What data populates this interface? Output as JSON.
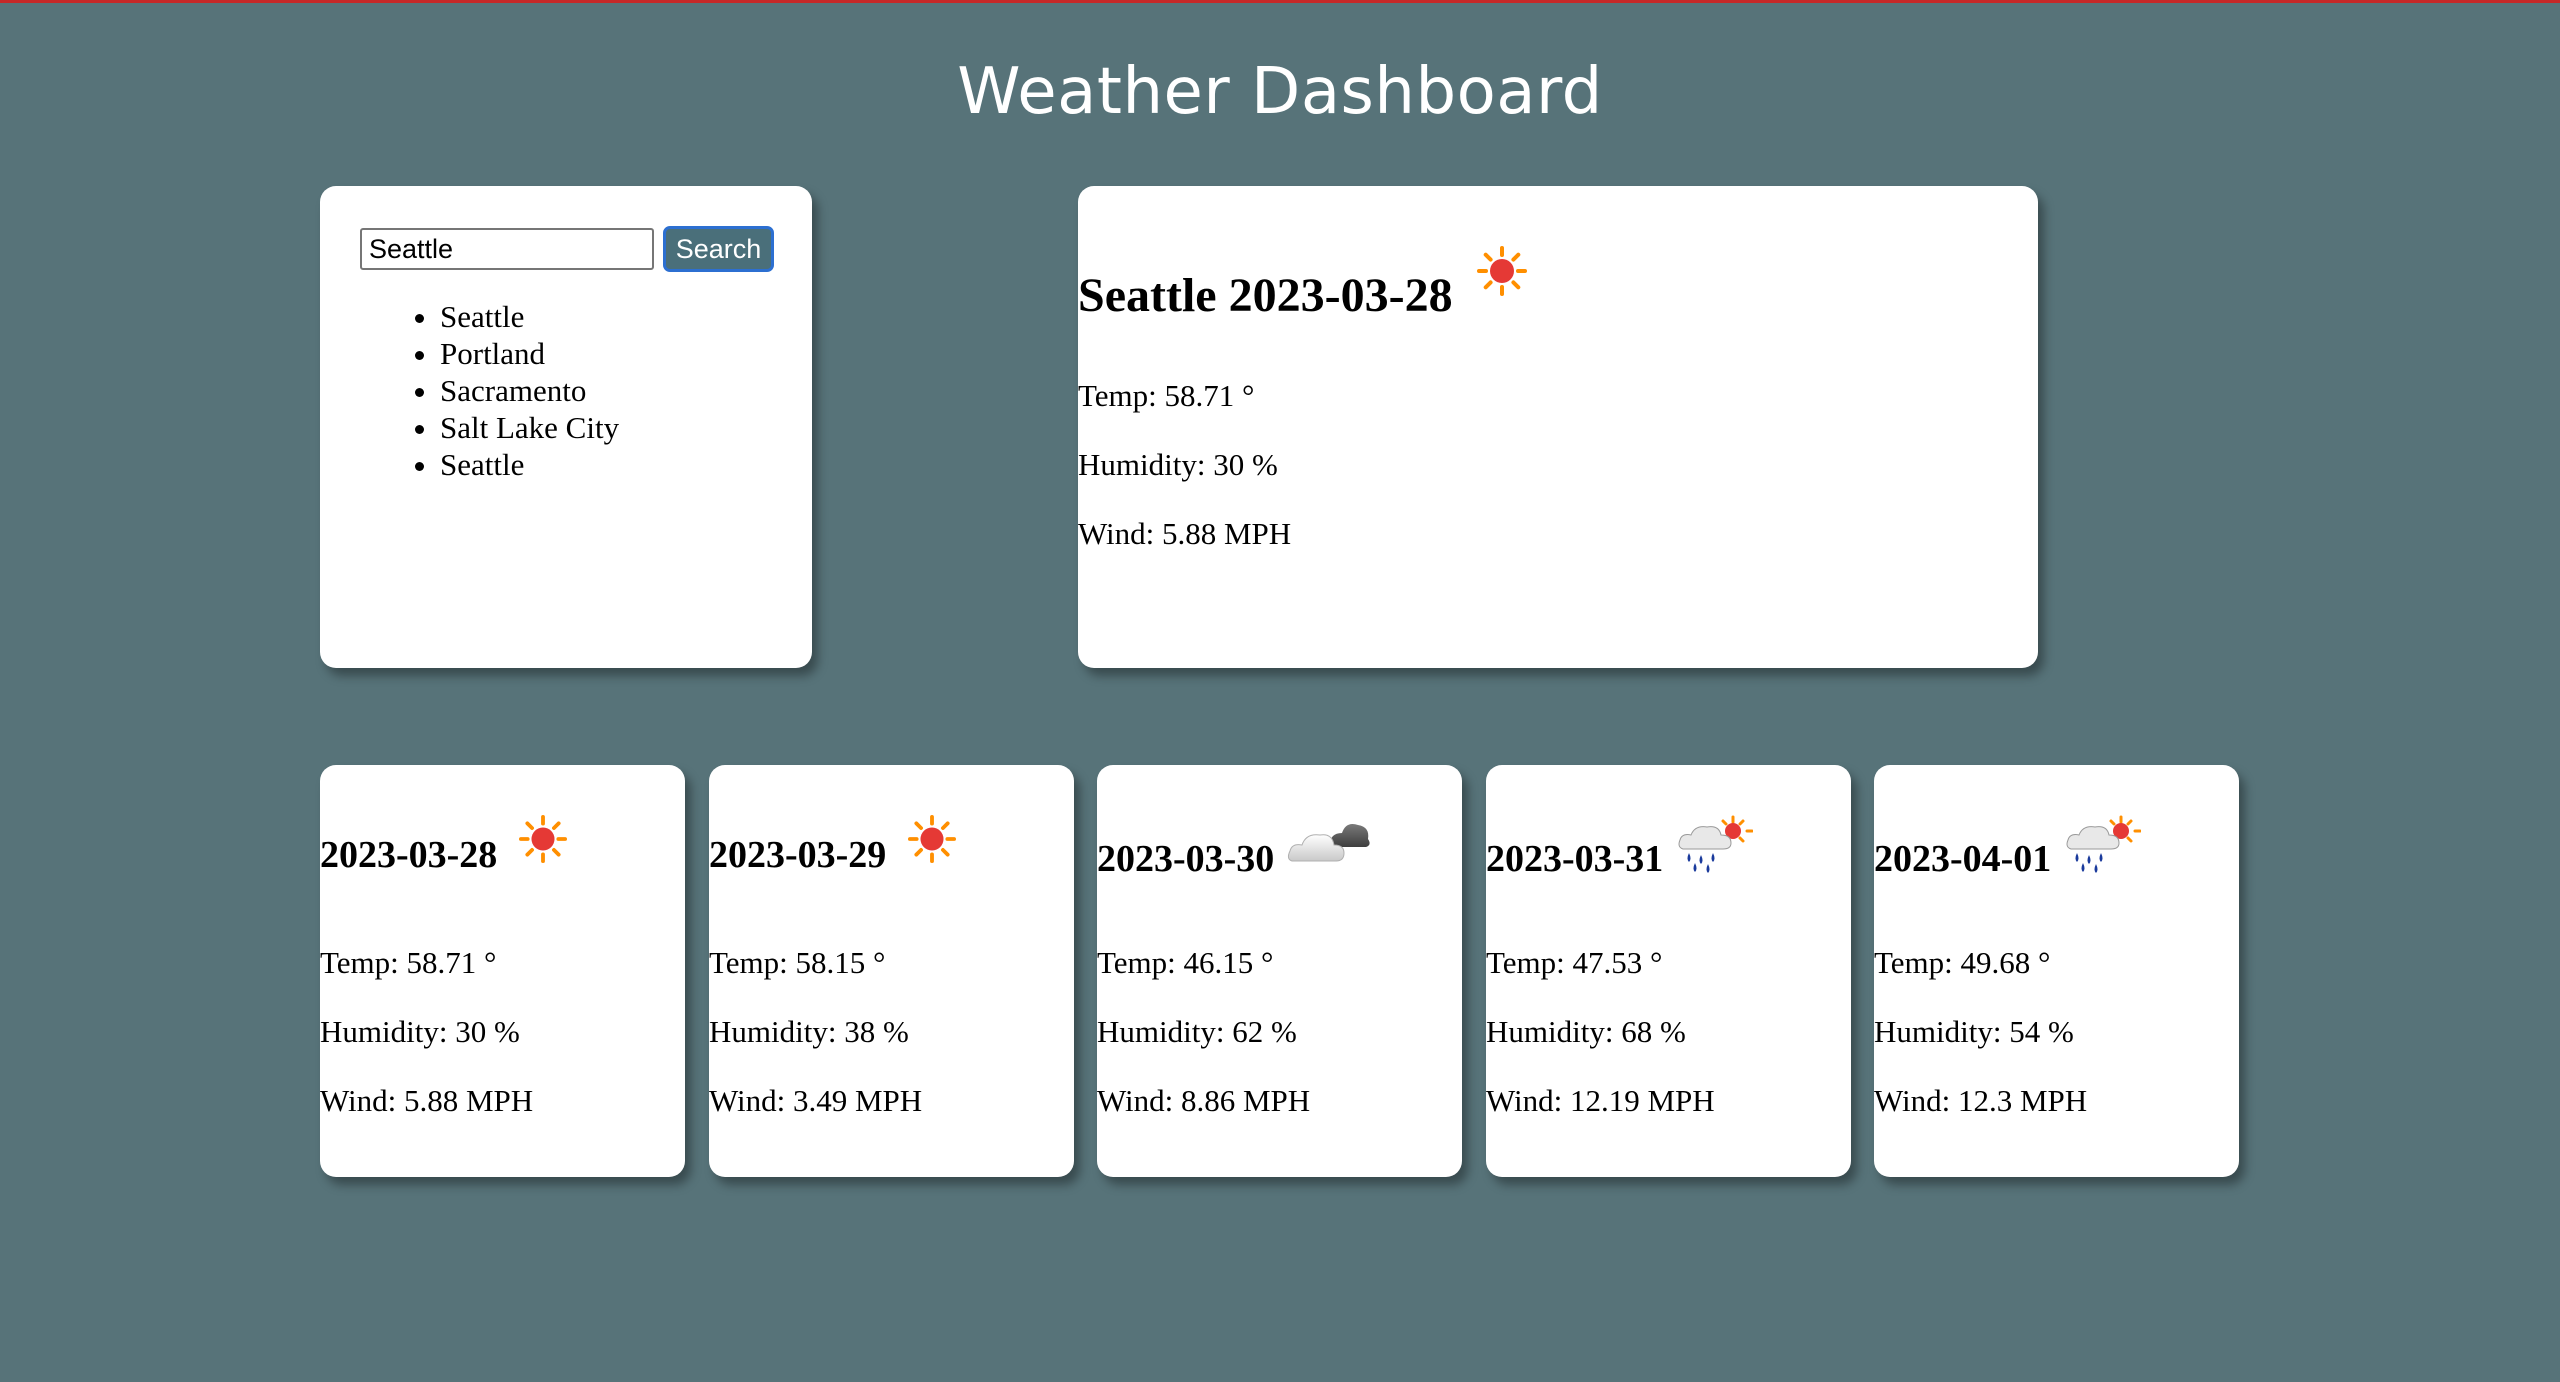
{
  "header": {
    "title": "Weather Dashboard"
  },
  "search": {
    "value": "Seattle",
    "button_label": "Search"
  },
  "history": [
    "Seattle",
    "Portland",
    "Sacramento",
    "Salt Lake City",
    "Seattle"
  ],
  "current": {
    "heading": "Seattle 2023-03-28",
    "icon": "sun-icon",
    "temp": "Temp: 58.71 °",
    "humidity": "Humidity: 30 %",
    "wind": "Wind: 5.88 MPH"
  },
  "forecast": [
    {
      "date": "2023-03-28",
      "icon": "sun-icon",
      "temp": "Temp: 58.71 °",
      "humidity": "Humidity: 30 %",
      "wind": "Wind: 5.88 MPH"
    },
    {
      "date": "2023-03-29",
      "icon": "sun-icon",
      "temp": "Temp: 58.15 °",
      "humidity": "Humidity: 38 %",
      "wind": "Wind: 3.49 MPH"
    },
    {
      "date": "2023-03-30",
      "icon": "cloud-icon",
      "temp": "Temp: 46.15 °",
      "humidity": "Humidity: 62 %",
      "wind": "Wind: 8.86 MPH"
    },
    {
      "date": "2023-03-31",
      "icon": "sun-rain-icon",
      "temp": "Temp: 47.53 °",
      "humidity": "Humidity: 68 %",
      "wind": "Wind: 12.19 MPH"
    },
    {
      "date": "2023-04-01",
      "icon": "sun-rain-icon",
      "temp": "Temp: 49.68 °",
      "humidity": "Humidity: 54 %",
      "wind": "Wind: 12.3 MPH"
    }
  ],
  "colors": {
    "background": "#577379",
    "button": "#4a6f7a",
    "sun": "#e53935",
    "sun_rays": "#ff8f00",
    "rain": "#1a3a9c"
  }
}
